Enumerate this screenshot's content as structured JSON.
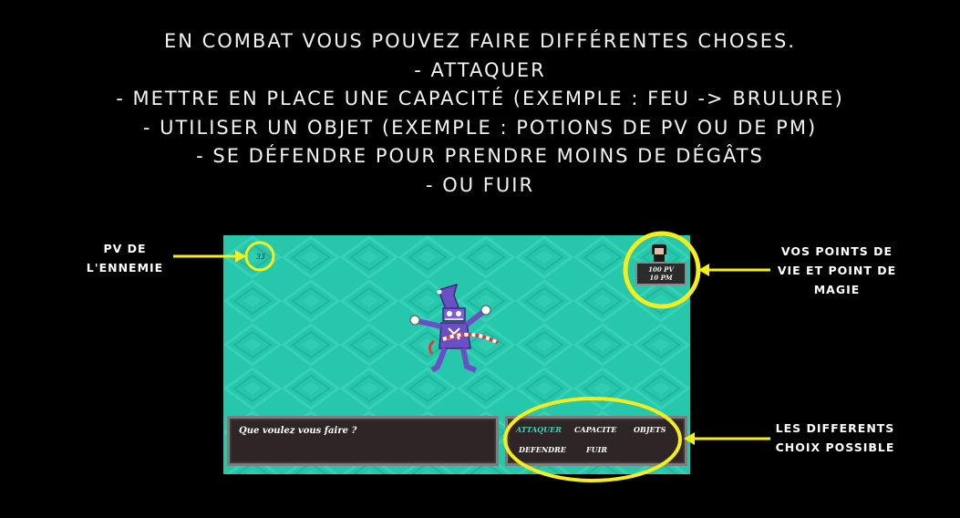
{
  "intro": {
    "lines": [
      "EN COMBAT VOUS POUVEZ FAIRE DIFFÉRENTES CHOSES.",
      "- ATTAQUER",
      "- METTRE EN PLACE UNE CAPACITÉ (EXEMPLE : FEU -> BRULURE)",
      "- UTILISER UN OBJET (EXEMPLE : POTIONS DE PV OU DE PM)",
      "- SE DÉFENDRE POUR PRENDRE MOINS DE DÉGÂTS",
      "- OU FUIR"
    ]
  },
  "callouts": {
    "enemy_hp": [
      "PV DE",
      "L'ENNEMIE"
    ],
    "player_stats": [
      "VOS POINTS DE",
      "VIE ET POINT DE",
      "MAGIE"
    ],
    "choices": [
      "LES DIFFERENTS",
      "CHOIX POSSIBLE"
    ]
  },
  "game": {
    "enemy_hp": "33",
    "player_hp": "100 PV",
    "player_mp": "10 PM",
    "dialog": "Que voulez vous faire ?",
    "menu": {
      "attack": "ATTAQUER",
      "ability": "CAPACITE",
      "items": "OBJETS",
      "defend": "DEFENDRE",
      "flee": "FUIR",
      "selected": "attack"
    }
  },
  "colors": {
    "background": "#000000",
    "game_bg": "#27c7ac",
    "highlight": "#f5ee1c",
    "menu_selected": "#38d6b8",
    "enemy": "#6b4fc4"
  },
  "icons": {
    "enemy": "jester-enemy-icon",
    "player": "player-portrait-icon"
  }
}
